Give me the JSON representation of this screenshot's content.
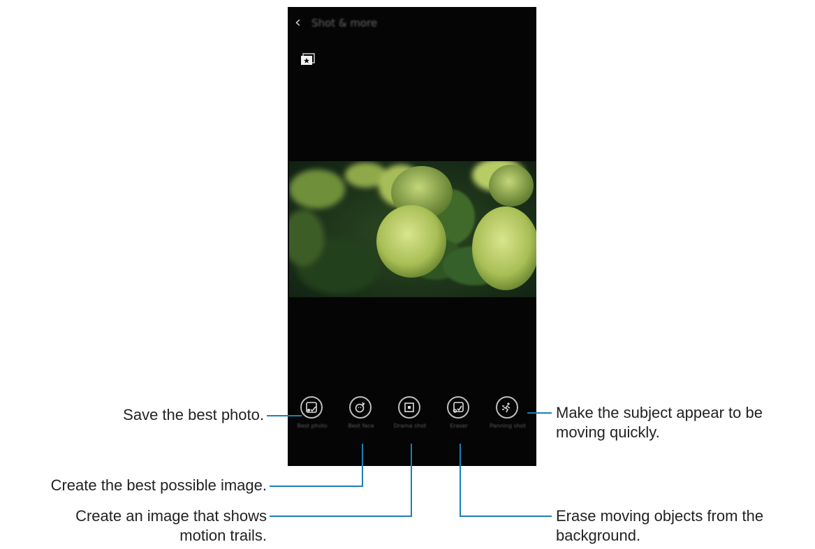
{
  "screen": {
    "back_glyph": "‹",
    "title": "Shot & more",
    "gallery_icon": "gallery-star-icon"
  },
  "modes": [
    {
      "label": "Best photo",
      "icon": "best-photo-icon"
    },
    {
      "label": "Best face",
      "icon": "best-face-icon"
    },
    {
      "label": "Drama shot",
      "icon": "drama-shot-icon"
    },
    {
      "label": "Eraser",
      "icon": "eraser-icon"
    },
    {
      "label": "Panning shot",
      "icon": "panning-shot-icon"
    }
  ],
  "callouts": {
    "best_photo": "Save the best photo.",
    "best_face": "Create the best possible image.",
    "drama_line1": "Create an image that shows",
    "drama_line2": "motion trails.",
    "panning_line1": "Make the subject appear to be",
    "panning_line2": "moving quickly.",
    "eraser_line1": "Erase moving objects from the",
    "eraser_line2": "background."
  },
  "colors": {
    "leader_line": "#1a7fb8",
    "screen_bg": "#050505"
  }
}
